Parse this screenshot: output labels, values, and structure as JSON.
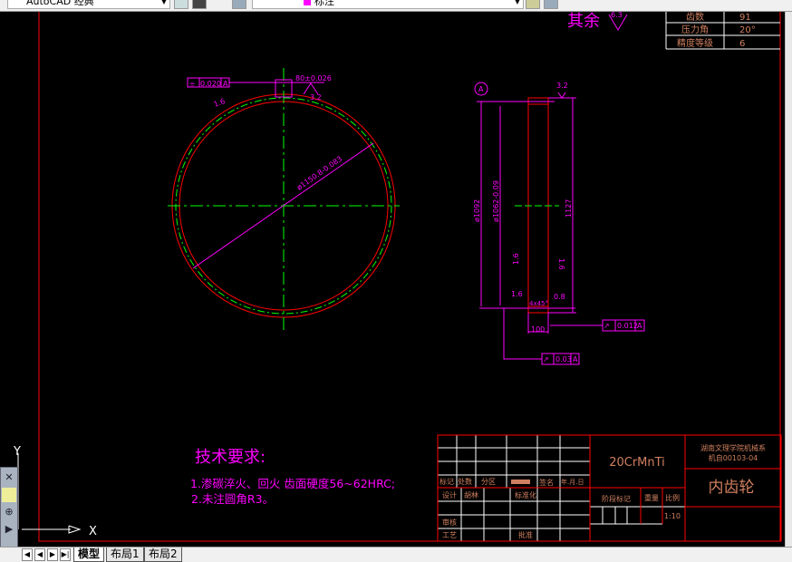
{
  "toolbar": {
    "workspace": "AutoCAD 经典",
    "layer": "标注"
  },
  "tabs": [
    {
      "label": "模型"
    },
    {
      "label": "布局1"
    },
    {
      "label": "布局2"
    }
  ],
  "ucs": {
    "x": "X",
    "y": "Y"
  },
  "gear_table": [
    {
      "label": "齿数",
      "value": "91"
    },
    {
      "label": "压力角",
      "value": "20°"
    },
    {
      "label": "精度等级",
      "value": "6"
    }
  ],
  "roughness_other": {
    "label": "其余",
    "value": "6.3"
  },
  "front_view": {
    "tolerance_frame": {
      "symbol": "⌯",
      "value": "0.020",
      "datum": "A"
    },
    "keyway_dim": "80±0.026",
    "roughness_top": "3.2",
    "roughness_left": "1.6",
    "diameter": "ø1150.8-0.083"
  },
  "side_view": {
    "datum": "A",
    "roughness_top": "3.2",
    "dim_outer": "ø1092",
    "dim_inner": "ø1062-0.09",
    "dim_height": "1127",
    "roughness_left": "1.6",
    "roughness_right": "1.6",
    "roughness_bottom_left": "1.6",
    "roughness_bottom_right": "0.8",
    "chamfer": "4x45°",
    "width": "100",
    "runout1": {
      "value": "0.012",
      "datum": "A"
    },
    "runout2": {
      "value": "0.03",
      "datum": "A"
    }
  },
  "tech_requirements": {
    "title": "技术要求:",
    "items": [
      "1.渗碳淬火、回火 齿面硬度56~62HRC;",
      "2.未注圆角R3。"
    ]
  },
  "title_block": {
    "material": "20CrMnTi",
    "org": "湖南文理学院机械系",
    "drawing_no": "机自00103-04",
    "part_name": "内齿轮",
    "labels": {
      "mark": "标记",
      "count": "处数",
      "zone": "分区",
      "sign": "签名",
      "date": "年.月.日",
      "design": "设计",
      "std": "标准化",
      "check": "审核",
      "process": "工艺",
      "approve": "批准",
      "stage": "阶段标记",
      "weight": "重量",
      "scale": "比例",
      "ds": "胡林"
    },
    "scale": "1:10"
  },
  "colors": {
    "red": "#ff0000",
    "magenta": "#ff00ff",
    "green": "#00ff00",
    "text": "#d08060"
  }
}
